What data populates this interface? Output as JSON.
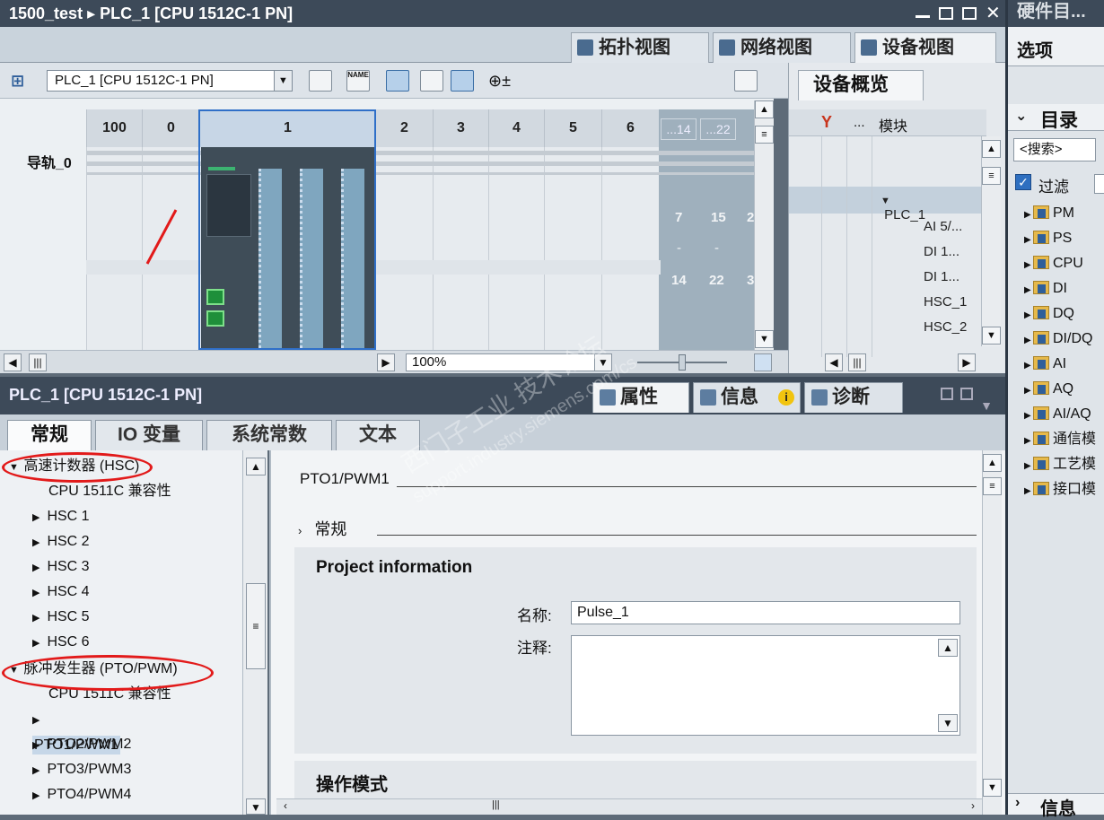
{
  "window": {
    "title": "1500_test ▸ PLC_1 [CPU 1512C-1 PN]"
  },
  "view_tabs": [
    {
      "label": "拓扑视图"
    },
    {
      "label": "网络视图"
    },
    {
      "label": "设备视图"
    }
  ],
  "toolbar": {
    "device_select": "PLC_1 [CPU 1512C-1 PN]"
  },
  "rack": {
    "rail_label": "导轨_0",
    "slots": [
      "100",
      "0",
      "1",
      "2",
      "3",
      "4",
      "5",
      "6",
      "...14",
      "...22"
    ],
    "extra_numbers": [
      "7",
      "15",
      "-",
      "-",
      "14",
      "22",
      "2",
      "3"
    ]
  },
  "status": {
    "zoom": "100%"
  },
  "device_overview": {
    "tab": "设备概览",
    "col_dots": "...",
    "col_module": "模块",
    "rows": [
      "PLC_1",
      "AI 5/...",
      "DI 1...",
      "DI 1...",
      "HSC_1",
      "HSC_2"
    ]
  },
  "properties": {
    "object_title": "PLC_1 [CPU 1512C-1 PN]",
    "tabs": [
      {
        "label": "属性"
      },
      {
        "label": "信息"
      },
      {
        "label": "诊断"
      }
    ],
    "subtabs": [
      "常规",
      "IO 变量",
      "系统常数",
      "文本"
    ]
  },
  "tree": {
    "items": [
      {
        "label": "高速计数器 (HSC)",
        "expanded": true
      },
      {
        "label": "CPU 1511C 兼容性"
      },
      {
        "label": "HSC 1"
      },
      {
        "label": "HSC 2"
      },
      {
        "label": "HSC 3"
      },
      {
        "label": "HSC 4"
      },
      {
        "label": "HSC 5"
      },
      {
        "label": "HSC 6"
      },
      {
        "label": "脉冲发生器 (PTO/PWM)",
        "expanded": true
      },
      {
        "label": "CPU 1511C 兼容性"
      },
      {
        "label": "PTO1/PWM1",
        "selected": true
      },
      {
        "label": "PTO2/PWM2"
      },
      {
        "label": "PTO3/PWM3"
      },
      {
        "label": "PTO4/PWM4"
      }
    ]
  },
  "content": {
    "heading": "PTO1/PWM1",
    "section_general": "常规",
    "project_info": "Project information",
    "name_label": "名称:",
    "name_value": "Pulse_1",
    "comment_label": "注释:",
    "op_mode": "操作模式"
  },
  "catalog": {
    "header": "硬件目...",
    "options": "选项",
    "section": "目录",
    "search_placeholder": "<搜索>",
    "filter_label": "过滤",
    "items": [
      "PM",
      "PS",
      "CPU",
      "DI",
      "DQ",
      "DI/DQ",
      "AI",
      "AQ",
      "AI/AQ",
      "通信模",
      "工艺模",
      "接口模"
    ],
    "bottom_section": "信息"
  },
  "watermark": {
    "line1": "西门子工业 技术论坛",
    "line2": "support.industry.siemens.com/cs"
  },
  "colors": {
    "title_bg": "#3d4a59",
    "accent": "#2f6fc8",
    "annotation_red": "#e21a1a"
  }
}
